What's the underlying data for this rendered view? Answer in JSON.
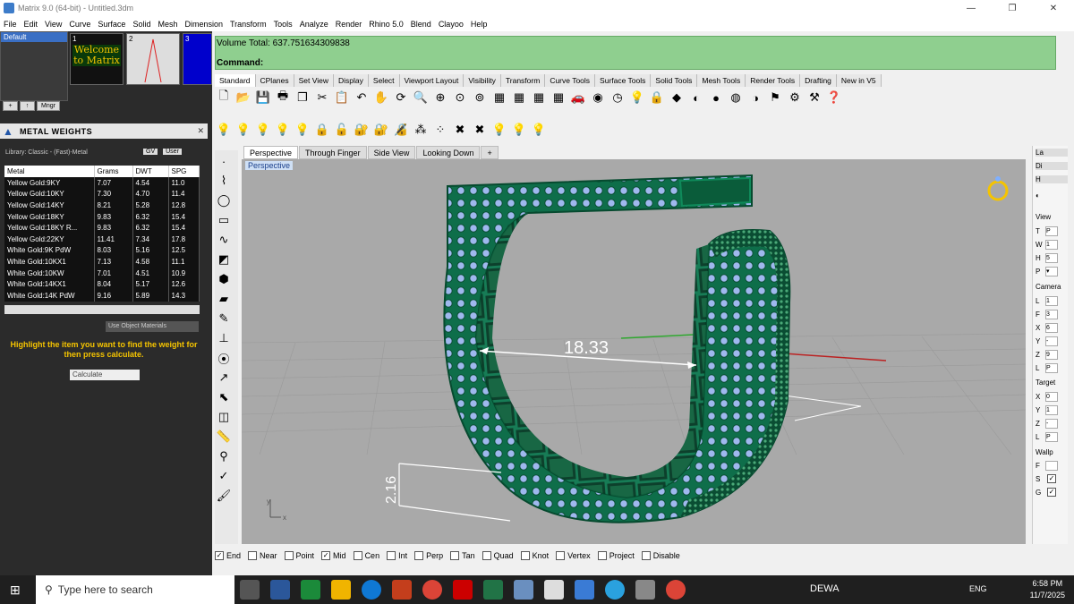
{
  "window": {
    "title": "Matrix 9.0 (64-bit) - Untitled.3dm",
    "min": "—",
    "max": "❐",
    "close": "✕"
  },
  "menu": [
    "File",
    "Edit",
    "View",
    "Curve",
    "Surface",
    "Solid",
    "Mesh",
    "Dimension",
    "Transform",
    "Tools",
    "Analyze",
    "Render",
    "Rhino 5.0",
    "Blend",
    "Clayoo",
    "Help"
  ],
  "layer": {
    "name": "Default",
    "mngr": "Mngr"
  },
  "thumbs": [
    {
      "num": "1",
      "text": "Welcome to Matrix"
    },
    {
      "num": "2",
      "text": ""
    },
    {
      "num": "3",
      "text": ""
    }
  ],
  "metal_weights": {
    "title": "METAL WEIGHTS",
    "library": "Library: Classic - (Fast)-Metal",
    "gv": "GV",
    "user": "User",
    "columns": [
      "Metal",
      "Grams",
      "DWT",
      "SPG"
    ],
    "rows": [
      [
        "Yellow Gold:9KY",
        "7.07",
        "4.54",
        "11.0"
      ],
      [
        "Yellow Gold:10KY",
        "7.30",
        "4.70",
        "11.4"
      ],
      [
        "Yellow Gold:14KY",
        "8.21",
        "5.28",
        "12.8"
      ],
      [
        "Yellow Gold:18KY",
        "9.83",
        "6.32",
        "15.4"
      ],
      [
        "Yellow Gold:18KY R...",
        "9.83",
        "6.32",
        "15.4"
      ],
      [
        "Yellow Gold:22KY",
        "11.41",
        "7.34",
        "17.8"
      ],
      [
        "White Gold:9K PdW",
        "8.03",
        "5.16",
        "12.5"
      ],
      [
        "White Gold:10KX1",
        "7.13",
        "4.58",
        "11.1"
      ],
      [
        "White Gold:10KW",
        "7.01",
        "4.51",
        "10.9"
      ],
      [
        "White Gold:14KX1",
        "8.04",
        "5.17",
        "12.6"
      ],
      [
        "White Gold:14K PdW",
        "9.16",
        "5.89",
        "14.3"
      ]
    ],
    "use_obj": "Use Object Materials",
    "hint": "Highlight the item you want to find the weight for then press calculate.",
    "calc": "Calculate"
  },
  "command": {
    "volume": "Volume Total: 637.751634309838",
    "prompt": "Command:"
  },
  "tabs": [
    "Standard",
    "CPlanes",
    "Set View",
    "Display",
    "Select",
    "Viewport Layout",
    "Visibility",
    "Transform",
    "Curve Tools",
    "Surface Tools",
    "Solid Tools",
    "Mesh Tools",
    "Render Tools",
    "Drafting",
    "New in V5"
  ],
  "viewport_tabs": [
    "Perspective",
    "Through Finger",
    "Side View",
    "Looking Down",
    "+"
  ],
  "viewport_label": "Perspective",
  "dims": {
    "width": "18.33",
    "height": "2.16"
  },
  "axis": {
    "y": "y",
    "x": "x"
  },
  "right_panel": {
    "tabs": [
      "La",
      "Di",
      "H"
    ],
    "view": "View",
    "t": "T",
    "tval": "P",
    "w": "W",
    "wval": "1",
    "h": "H",
    "hval": "5",
    "p": "P",
    "camera": "Camera",
    "cam": [
      [
        "L",
        "1"
      ],
      [
        "F",
        "3"
      ],
      [
        "X",
        "6"
      ],
      [
        "Y",
        "-"
      ],
      [
        "Z",
        "9"
      ],
      [
        "L",
        "P"
      ]
    ],
    "target": "Target",
    "tgt": [
      [
        "X",
        "0"
      ],
      [
        "Y",
        "1"
      ],
      [
        "Z",
        "-"
      ],
      [
        "L",
        "P"
      ]
    ],
    "wallp": "Wallp",
    "wp": [
      [
        "F",
        ""
      ],
      [
        "S",
        "✓"
      ],
      [
        "G",
        "✓"
      ]
    ]
  },
  "osnap": [
    {
      "label": "End",
      "on": true
    },
    {
      "label": "Near",
      "on": false
    },
    {
      "label": "Point",
      "on": false
    },
    {
      "label": "Mid",
      "on": true
    },
    {
      "label": "Cen",
      "on": false
    },
    {
      "label": "Int",
      "on": false
    },
    {
      "label": "Perp",
      "on": false
    },
    {
      "label": "Tan",
      "on": false
    },
    {
      "label": "Quad",
      "on": false
    },
    {
      "label": "Knot",
      "on": false
    },
    {
      "label": "Vertex",
      "on": false
    },
    {
      "label": "Project",
      "on": false
    },
    {
      "label": "Disable",
      "on": false
    }
  ],
  "taskbar": {
    "search": "Type here to search",
    "dewa": "DEWA",
    "lang": "ENG",
    "time": "6:58 PM",
    "date": "11/7/2025"
  }
}
